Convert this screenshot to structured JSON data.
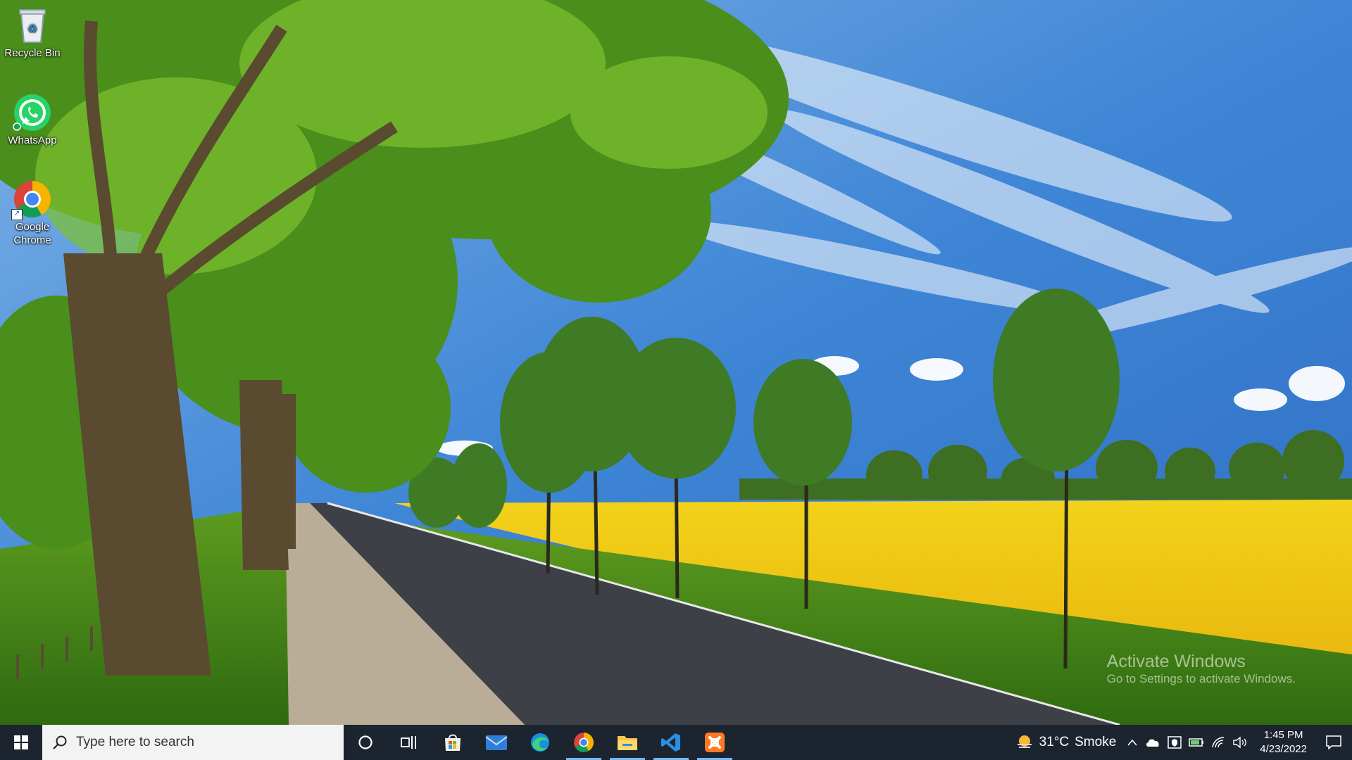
{
  "desktop": {
    "icons": [
      {
        "label": "Recycle Bin",
        "icon": "recycle-bin-icon"
      },
      {
        "label": "WhatsApp",
        "icon": "whatsapp-icon"
      },
      {
        "label": "Google Chrome",
        "icon": "chrome-icon"
      }
    ],
    "watermark": {
      "title": "Activate Windows",
      "subtitle": "Go to Settings to activate Windows."
    }
  },
  "taskbar": {
    "search_placeholder": "Type here to search",
    "pinned": [
      {
        "name": "cortana",
        "icon": "cortana-circle-icon"
      },
      {
        "name": "task-view",
        "icon": "task-view-icon"
      },
      {
        "name": "microsoft-store",
        "icon": "store-icon"
      },
      {
        "name": "mail",
        "icon": "mail-icon"
      },
      {
        "name": "edge",
        "icon": "edge-icon"
      },
      {
        "name": "chrome",
        "icon": "chrome-icon"
      },
      {
        "name": "file-explorer",
        "icon": "folder-icon"
      },
      {
        "name": "vscode",
        "icon": "vscode-icon"
      },
      {
        "name": "xampp",
        "icon": "xampp-icon"
      }
    ],
    "weather": {
      "temp": "31°C",
      "condition": "Smoke"
    },
    "clock": {
      "time": "1:45 PM",
      "date": "4/23/2022"
    },
    "colors": {
      "taskbar": "#1c2430",
      "active_indicator": "#76b9ed"
    }
  }
}
